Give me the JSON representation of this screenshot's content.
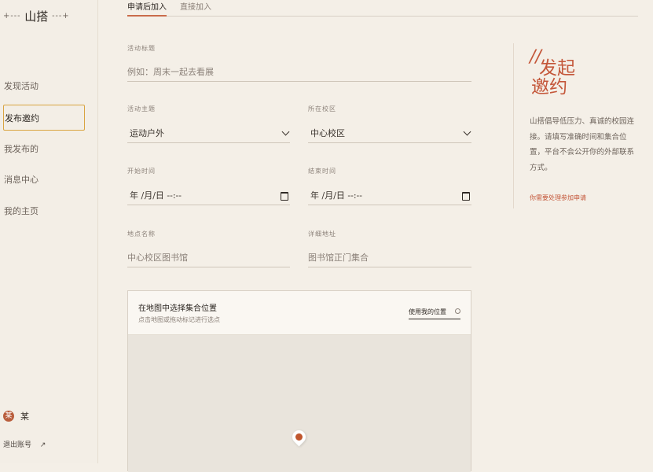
{
  "app": {
    "logo": "山搭",
    "logo_left": "+---",
    "logo_right": "---+"
  },
  "sidebar": {
    "items": [
      {
        "label": "发现活动",
        "active": false
      },
      {
        "label": "发布邀约",
        "active": true
      },
      {
        "label": "我发布的",
        "active": false
      },
      {
        "label": "消息中心",
        "active": false
      },
      {
        "label": "我的主页",
        "active": false
      }
    ],
    "user": {
      "avatar_char": "某",
      "name": "某"
    },
    "logout_label": "退出账号",
    "logout_icon": "↗"
  },
  "tabs": [
    {
      "label": "申请后加入",
      "active": true
    },
    {
      "label": "直接加入",
      "active": false
    }
  ],
  "form": {
    "title": {
      "label": "活动标题",
      "placeholder": "例如：周末一起去看展"
    },
    "theme": {
      "label": "活动主题",
      "value": "运动户外"
    },
    "campus": {
      "label": "所在校区",
      "value": "中心校区"
    },
    "start": {
      "label": "开始时间",
      "value": "年 /月/日 --:--"
    },
    "end": {
      "label": "结束时间",
      "value": "年 /月/日 --:--"
    },
    "place": {
      "label": "地点名称",
      "placeholder": "中心校区图书馆"
    },
    "address": {
      "label": "详细地址",
      "placeholder": "图书馆正门集合"
    }
  },
  "map": {
    "title": "在地图中选择集合位置",
    "subtitle": "点击地图或拖动标记进行选点",
    "use_location": "使用我的位置"
  },
  "side_panel": {
    "heading_1": "发起",
    "heading_2": "邀约",
    "description": "山搭倡导低压力、真诚的校园连接。请填写准确时间和集合位置，平台不会公开你的外部联系方式。",
    "link": "你需要处理参加申请"
  },
  "colors": {
    "accent": "#c4573a",
    "active_border": "#d9a441",
    "background": "#f4efe7"
  }
}
